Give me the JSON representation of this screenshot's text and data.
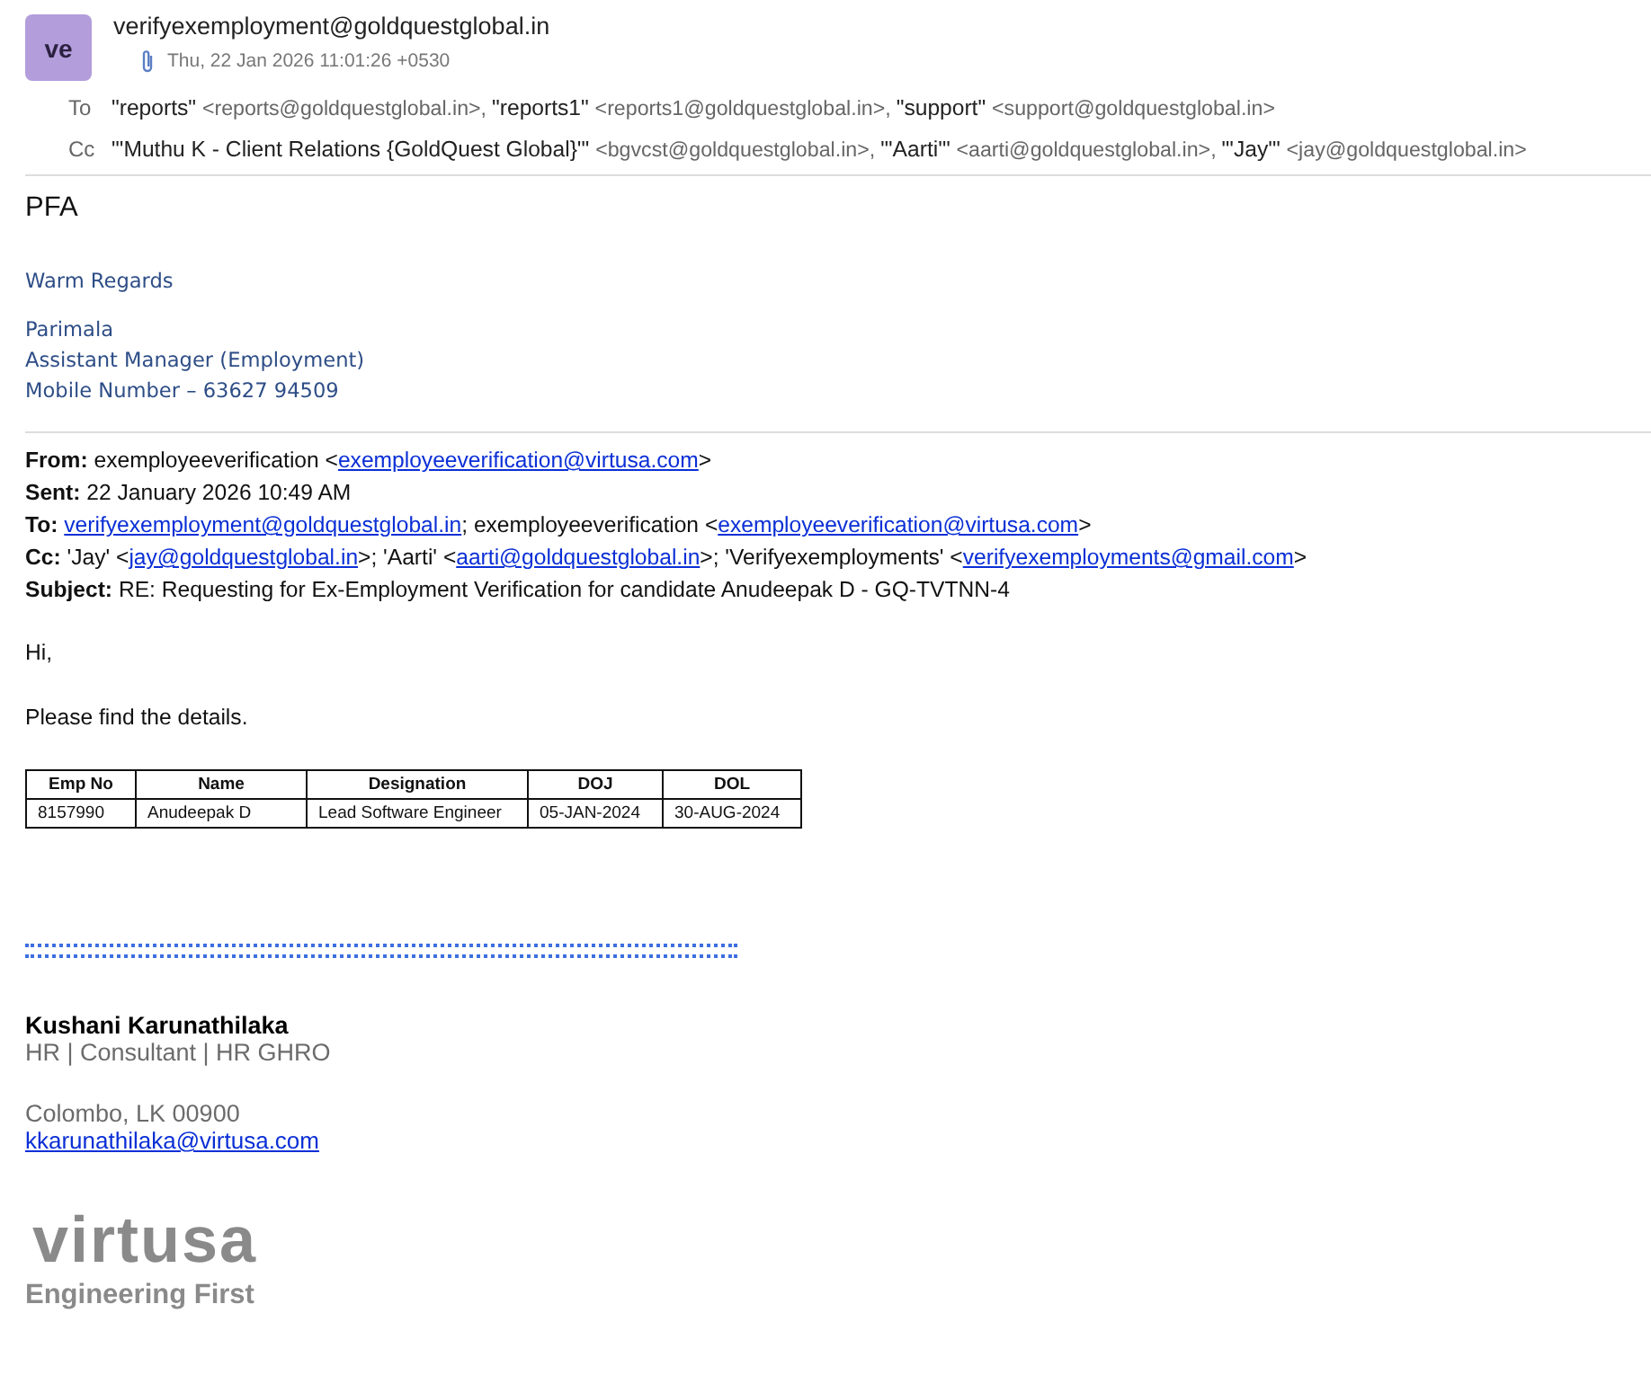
{
  "sender": {
    "avatar": "ve",
    "address": "verifyexemployment@goldquestglobal.in",
    "date": "Thu, 22 Jan 2026 11:01:26 +0530",
    "has_attachment": true
  },
  "recipients": [
    {
      "label": "To",
      "people": [
        {
          "name": "\"reports\"",
          "address": "<reports@goldquestglobal.in>,"
        },
        {
          "name": "\"reports1\"",
          "address": "<reports1@goldquestglobal.in>,"
        },
        {
          "name": "\"support\"",
          "address": "<support@goldquestglobal.in>"
        }
      ]
    },
    {
      "label": "Cc",
      "people": [
        {
          "name": "\"'Muthu K - Client Relations {GoldQuest Global}'\"",
          "address": "<bgvcst@goldquestglobal.in>,"
        },
        {
          "name": "\"'Aarti'\"",
          "address": "<aarti@goldquestglobal.in>,"
        },
        {
          "name": "\"'Jay'\"",
          "address": "<jay@goldquestglobal.in>"
        }
      ]
    }
  ],
  "body": {
    "greeting": "PFA",
    "closing": "Warm Regards",
    "signature": [
      "Parimala",
      "Assistant Manager (Employment)",
      "Mobile Number – 63627 94509"
    ]
  },
  "quoted_header": [
    {
      "label": "From:",
      "parts": [
        {
          "kind": "text",
          "text": "exemployeeverification <"
        },
        {
          "kind": "link",
          "text": "exemployeeverification@virtusa.com"
        },
        {
          "kind": "text",
          "text": ">"
        }
      ]
    },
    {
      "label": "Sent:",
      "parts": [
        {
          "kind": "text",
          "text": "22 January 2026 10:49 AM"
        }
      ]
    },
    {
      "label": "To:",
      "parts": [
        {
          "kind": "link",
          "text": "verifyexemployment@goldquestglobal.in"
        },
        {
          "kind": "text",
          "text": "; exemployeeverification <"
        },
        {
          "kind": "link",
          "text": "exemployeeverification@virtusa.com"
        },
        {
          "kind": "text",
          "text": ">"
        }
      ]
    },
    {
      "label": "Cc:",
      "parts": [
        {
          "kind": "text",
          "text": "'Jay' <"
        },
        {
          "kind": "link",
          "text": "jay@goldquestglobal.in"
        },
        {
          "kind": "text",
          "text": ">; 'Aarti' <"
        },
        {
          "kind": "link",
          "text": "aarti@goldquestglobal.in"
        },
        {
          "kind": "text",
          "text": ">; 'Verifyexemployments' <"
        },
        {
          "kind": "link",
          "text": "verifyexemployments@gmail.com"
        },
        {
          "kind": "text",
          "text": ">"
        }
      ]
    },
    {
      "label": "Subject:",
      "parts": [
        {
          "kind": "text",
          "text": "RE: Requesting for Ex-Employment Verification for candidate Anudeepak D - GQ-TVTNN-4"
        }
      ]
    }
  ],
  "quoted_body": [
    "Hi,",
    "Please find the details."
  ],
  "table": {
    "columns": [
      "Emp  No",
      "Name",
      "Designation",
      "DOJ",
      "DOL"
    ],
    "rows": [
      [
        "8157990",
        "Anudeepak D",
        "Lead Software Engineer",
        "05-JAN-2024",
        "30-AUG-2024"
      ]
    ]
  },
  "footer": {
    "name": "Kushani Karunathilaka",
    "title": "HR | Consultant | HR GHRO",
    "location": "Colombo, LK 00900",
    "email": "kkarunathilaka@virtusa.com",
    "logo": "virtusa",
    "tagline": "Engineering First"
  }
}
